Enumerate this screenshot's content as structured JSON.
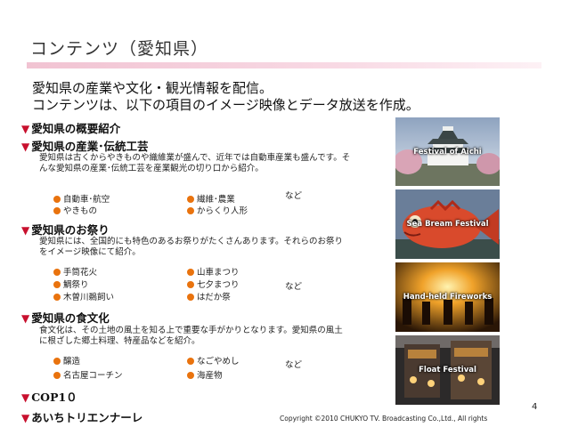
{
  "title": "コンテンツ（愛知県）",
  "intro": [
    "愛知県の産業や文化・観光情報を配信。",
    "コンテンツは、以下の項目のイメージ映像とデータ放送を作成。"
  ],
  "sections": {
    "overview": {
      "heading": "愛知県の概要紹介"
    },
    "industry": {
      "heading": "愛知県の産業･伝統工芸",
      "desc": "愛知県は古くからやきものや織維業が盛んで、近年では自動車産業も盛んです。そんな愛知県の産業･伝統工芸を産業観光の切り口から紹介。",
      "items": [
        "自動車･航空",
        "やきもの",
        "繊維･農業",
        "からくり人形"
      ],
      "etc": "など"
    },
    "festival": {
      "heading": "愛知県のお祭り",
      "desc": "愛知県には、全国的にも特色のあるお祭りがたくさんあります。それらのお祭りをイメージ映像にて紹介。",
      "items": [
        "手筒花火",
        "鯛祭り",
        "木曽川鵜飼い",
        "山車まつり",
        "七夕まつり",
        "はだか祭"
      ],
      "etc": "など"
    },
    "food": {
      "heading": "愛知県の食文化",
      "desc": "食文化は、その土地の風土を知る上で重要な手がかりとなります。愛知県の風土に根ざした郷土料理、特産品などを紹介。",
      "items": [
        "醸造",
        "名古屋コーチン",
        "なごやめし",
        "海産物"
      ],
      "etc": "など"
    },
    "cop10": {
      "heading": "COP1０"
    },
    "triennale": {
      "heading": "あいちトリエンナーレ"
    }
  },
  "photos": [
    {
      "caption": "Festival of Aichi"
    },
    {
      "caption": "Sea Bream Festival"
    },
    {
      "caption": "Hand-held Fireworks"
    },
    {
      "caption": "Float Festival"
    }
  ],
  "footer": {
    "copyright": "Copyright ©2010 CHUKYO TV. Broadcasting Co.,Ltd., All rights",
    "page_number": "4"
  }
}
